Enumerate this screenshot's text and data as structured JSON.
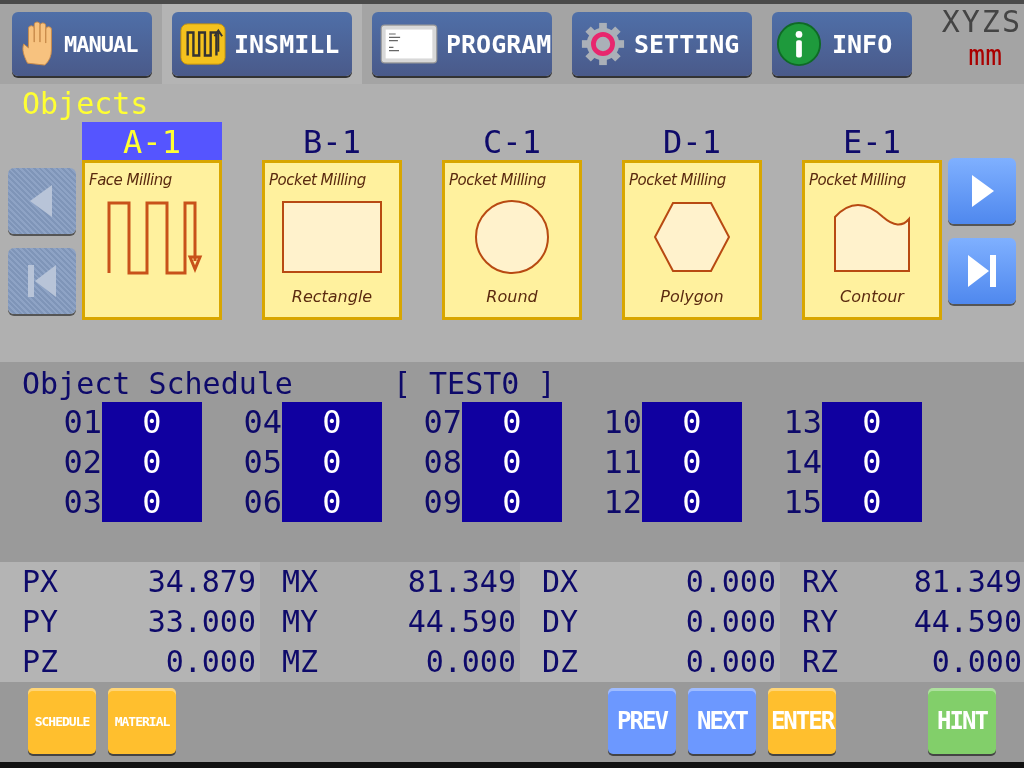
{
  "tabs": [
    {
      "label": "MANUAL",
      "kind": "hand",
      "selected": false
    },
    {
      "label": "INSMILL",
      "kind": "insmill",
      "selected": true
    },
    {
      "label": "PROGRAM",
      "kind": "program",
      "selected": false
    },
    {
      "label": "SETTING",
      "kind": "gear",
      "selected": false
    },
    {
      "label": "INFO",
      "kind": "info",
      "selected": false
    }
  ],
  "axes_label": "XYZS",
  "unit": "mm",
  "objects": {
    "title": "Objects",
    "nav_left": [
      {
        "kind": "prev",
        "disabled": true
      },
      {
        "kind": "first",
        "disabled": true
      }
    ],
    "nav_right": [
      {
        "kind": "next",
        "disabled": false
      },
      {
        "kind": "last",
        "disabled": false
      }
    ],
    "items": [
      {
        "label": "A-1",
        "selected": true,
        "operation": "Face Milling",
        "kind": "zigzag"
      },
      {
        "label": "B-1",
        "selected": false,
        "operation": "Pocket Milling",
        "shape": "Rectangle",
        "kind": "rectangle"
      },
      {
        "label": "C-1",
        "selected": false,
        "operation": "Pocket Milling",
        "shape": "Round",
        "kind": "circle"
      },
      {
        "label": "D-1",
        "selected": false,
        "operation": "Pocket Milling",
        "shape": "Polygon",
        "kind": "hexagon"
      },
      {
        "label": "E-1",
        "selected": false,
        "operation": "Pocket Milling",
        "shape": "Contour",
        "kind": "contour"
      }
    ]
  },
  "schedule": {
    "title": "Object Schedule",
    "program": "[ TEST0 ]",
    "slots": [
      {
        "number": "01",
        "value": "0"
      },
      {
        "number": "02",
        "value": "0"
      },
      {
        "number": "03",
        "value": "0"
      },
      {
        "number": "04",
        "value": "0"
      },
      {
        "number": "05",
        "value": "0"
      },
      {
        "number": "06",
        "value": "0"
      },
      {
        "number": "07",
        "value": "0"
      },
      {
        "number": "08",
        "value": "0"
      },
      {
        "number": "09",
        "value": "0"
      },
      {
        "number": "10",
        "value": "0"
      },
      {
        "number": "11",
        "value": "0"
      },
      {
        "number": "12",
        "value": "0"
      },
      {
        "number": "13",
        "value": "0"
      },
      {
        "number": "14",
        "value": "0"
      },
      {
        "number": "15",
        "value": "0"
      }
    ]
  },
  "coordinates": [
    [
      {
        "name": "PX",
        "value": "34.879"
      },
      {
        "name": "PY",
        "value": "33.000"
      },
      {
        "name": "PZ",
        "value": "0.000"
      }
    ],
    [
      {
        "name": "MX",
        "value": "81.349"
      },
      {
        "name": "MY",
        "value": "44.590"
      },
      {
        "name": "MZ",
        "value": "0.000"
      }
    ],
    [
      {
        "name": "DX",
        "value": "0.000"
      },
      {
        "name": "DY",
        "value": "0.000"
      },
      {
        "name": "DZ",
        "value": "0.000"
      }
    ],
    [
      {
        "name": "RX",
        "value": "81.349"
      },
      {
        "name": "RY",
        "value": "44.590"
      },
      {
        "name": "RZ",
        "value": "0.000"
      }
    ]
  ],
  "buttons": [
    {
      "label": "SCHEDULE",
      "color": "#ffbf2e"
    },
    {
      "label": "MATERIAL",
      "color": "#ffbf2e"
    },
    {
      "label": "PREV",
      "color": "#6c98ff"
    },
    {
      "label": "NEXT",
      "color": "#6c98ff"
    },
    {
      "label": "ENTER",
      "color": "#ffbf2e"
    },
    {
      "label": "HINT",
      "color": "#82cf6a"
    }
  ]
}
